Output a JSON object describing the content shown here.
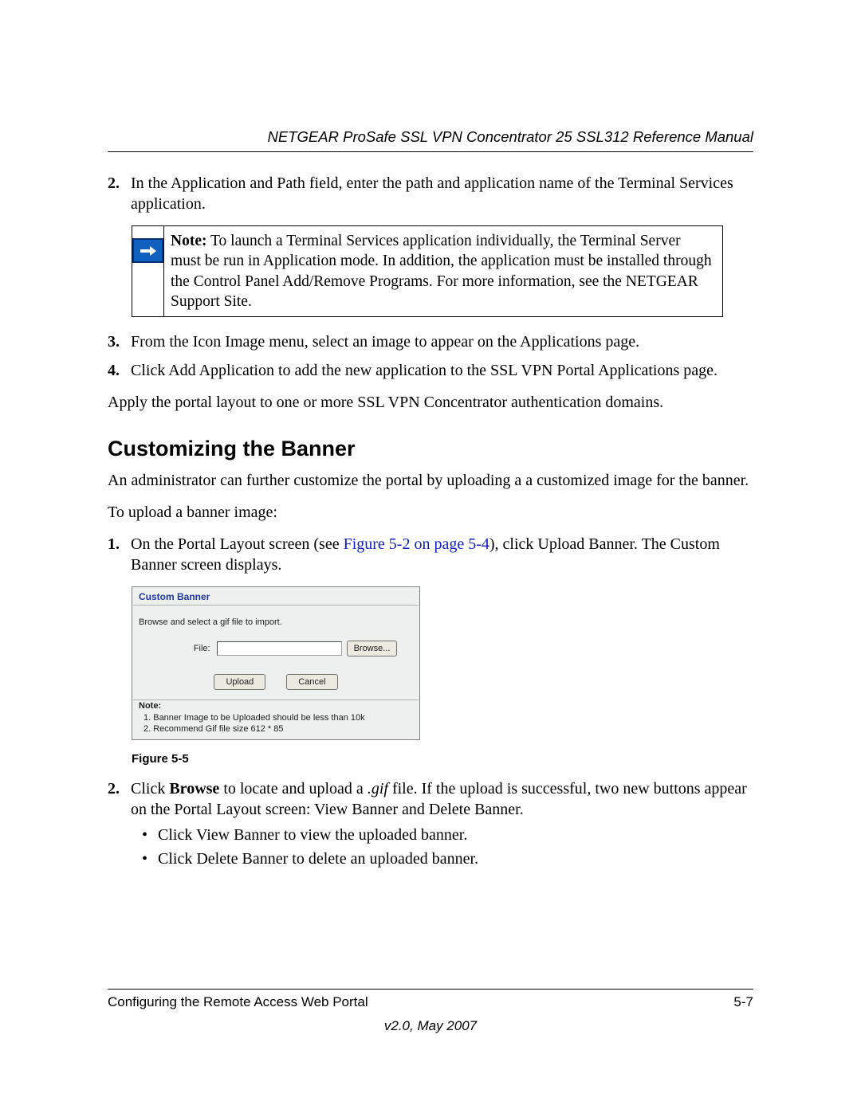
{
  "header": {
    "running_title": "NETGEAR ProSafe SSL VPN Concentrator 25 SSL312 Reference Manual"
  },
  "list_a": {
    "item2_num": "2.",
    "item2_text": "In the Application and Path field, enter the path and application name of the Terminal Services application."
  },
  "note": {
    "prefix": "Note:",
    "text": " To launch a Terminal Services application individually, the Terminal Server must be run in Application mode. In addition, the application must be installed through the Control Panel Add/Remove Programs. For more information, see the NETGEAR Support Site."
  },
  "list_b": {
    "item3_num": "3.",
    "item3_text": "From the Icon Image menu, select an image to appear on the Applications page.",
    "item4_num": "4.",
    "item4_text": "Click Add Application to add the new application to the SSL VPN Portal Applications page."
  },
  "para_apply": "Apply the portal layout to one or more SSL VPN Concentrator authentication domains.",
  "section_title": "Customizing the Banner",
  "para_intro": "An administrator can further customize the portal by uploading a a customized image for the banner.",
  "para_upload": "To upload a banner image:",
  "list_c": {
    "item1_num": "1.",
    "item1_pre": "On the Portal Layout screen (see ",
    "item1_link": "Figure 5-2 on page 5-4",
    "item1_post": "), click Upload Banner. The Custom Banner screen displays."
  },
  "figure": {
    "title": "Custom Banner",
    "instruction": "Browse and select a gif file to import.",
    "file_label": "File:",
    "browse_btn": "Browse...",
    "upload_btn": "Upload",
    "cancel_btn": "Cancel",
    "note_head": "Note:",
    "note1": "1. Banner Image to be Uploaded should be less than 10k",
    "note2": "2. Recommend Gif file size 612 * 85",
    "caption": "Figure 5-5"
  },
  "list_d": {
    "item2_num": "2.",
    "item2_pre": "Click ",
    "item2_bold": "Browse",
    "item2_mid": " to locate and upload a ",
    "item2_italic": ".gif",
    "item2_post": " file. If the upload is successful, two new buttons appear on the Portal Layout screen: View Banner and Delete Banner.",
    "bullet1": "Click View Banner to view the uploaded banner.",
    "bullet2": "Click Delete Banner to delete an uploaded banner."
  },
  "footer": {
    "left": "Configuring the Remote Access Web Portal",
    "right": "5-7",
    "version": "v2.0, May 2007"
  }
}
